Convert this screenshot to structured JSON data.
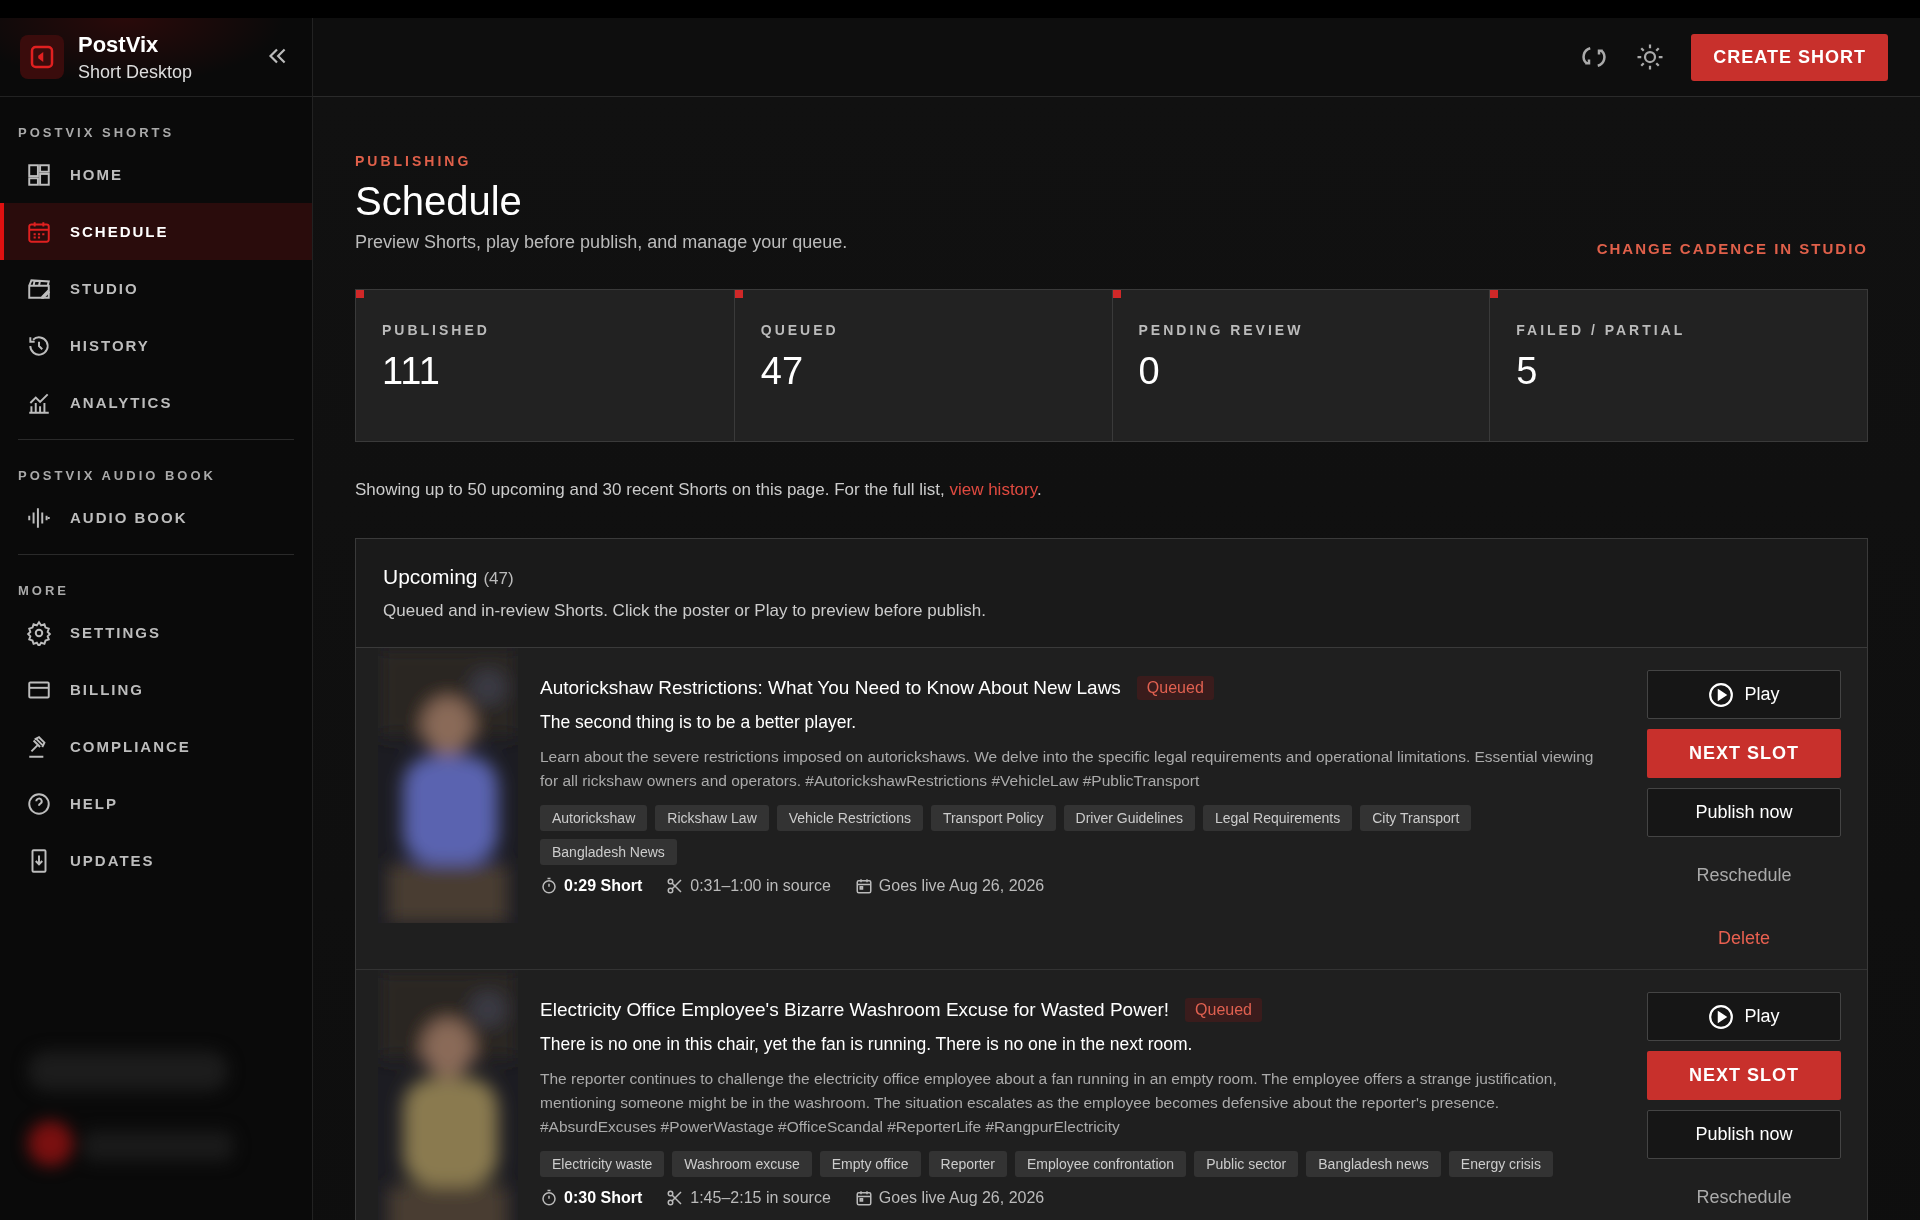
{
  "brand": {
    "name": "PostVix",
    "subtitle": "Short Desktop"
  },
  "sidebar": {
    "sections": [
      {
        "label": "POSTVIX SHORTS",
        "items": [
          {
            "label": "HOME",
            "selected": false
          },
          {
            "label": "SCHEDULE",
            "selected": true
          },
          {
            "label": "STUDIO",
            "selected": false
          },
          {
            "label": "HISTORY",
            "selected": false
          },
          {
            "label": "ANALYTICS",
            "selected": false
          }
        ]
      },
      {
        "label": "POSTVIX AUDIO BOOK",
        "items": [
          {
            "label": "AUDIO BOOK",
            "selected": false
          }
        ]
      },
      {
        "label": "MORE",
        "items": [
          {
            "label": "SETTINGS",
            "selected": false
          },
          {
            "label": "BILLING",
            "selected": false
          },
          {
            "label": "COMPLIANCE",
            "selected": false
          },
          {
            "label": "HELP",
            "selected": false
          },
          {
            "label": "UPDATES",
            "selected": false
          }
        ]
      }
    ]
  },
  "header": {
    "create_button": "CREATE SHORT"
  },
  "page": {
    "eyebrow": "PUBLISHING",
    "title": "Schedule",
    "subtitle": "Preview Shorts, play before publish, and manage your queue.",
    "cadence_link": "CHANGE CADENCE IN STUDIO"
  },
  "stats": [
    {
      "label": "PUBLISHED",
      "value": "111"
    },
    {
      "label": "QUEUED",
      "value": "47"
    },
    {
      "label": "PENDING REVIEW",
      "value": "0"
    },
    {
      "label": "FAILED / PARTIAL",
      "value": "5"
    }
  ],
  "notice": {
    "text": "Showing up to 50 upcoming and 30 recent Shorts on this page. For the full list, ",
    "link": "view history",
    "end": "."
  },
  "upcoming": {
    "title": "Upcoming",
    "count": "(47)",
    "description": "Queued and in-review Shorts. Click the poster or Play to preview before publish.",
    "items": [
      {
        "title": "Autorickshaw Restrictions: What You Need to Know About New Laws",
        "status": "Queued",
        "hook": "The second thing is to be a better player.",
        "description": "Learn about the severe restrictions imposed on autorickshaws. We delve into the specific legal requirements and operational limitations. Essential viewing for all rickshaw owners and operators. #AutorickshawRestrictions #VehicleLaw #PublicTransport",
        "tags": [
          "Autorickshaw",
          "Rickshaw Law",
          "Vehicle Restrictions",
          "Transport Policy",
          "Driver Guidelines",
          "Legal Requirements",
          "City Transport",
          "Bangladesh News"
        ],
        "duration": "0:29 Short",
        "source": "0:31–1:00 in source",
        "golive": "Goes live Aug 26, 2026",
        "actions": {
          "play": "Play",
          "next": "NEXT SLOT",
          "publish": "Publish now",
          "reschedule": "Reschedule",
          "delete": "Delete"
        }
      },
      {
        "title": "Electricity Office Employee's Bizarre Washroom Excuse for Wasted Power!",
        "status": "Queued",
        "hook": "There is no one in this chair, yet the fan is running. There is no one in the next room.",
        "description": "The reporter continues to challenge the electricity office employee about a fan running in an empty room. The employee offers a strange justification, mentioning someone might be in the washroom. The situation escalates as the employee becomes defensive about the reporter's presence. #AbsurdExcuses #PowerWastage #OfficeScandal #ReporterLife #RangpurElectricity",
        "tags": [
          "Electricity waste",
          "Washroom excuse",
          "Empty office",
          "Reporter",
          "Employee confrontation",
          "Public sector",
          "Bangladesh news",
          "Energy crisis"
        ],
        "duration": "0:30 Short",
        "source": "1:45–2:15 in source",
        "golive": "Goes live Aug 26, 2026",
        "actions": {
          "play": "Play",
          "next": "NEXT SLOT",
          "publish": "Publish now",
          "reschedule": "Reschedule"
        }
      }
    ]
  }
}
